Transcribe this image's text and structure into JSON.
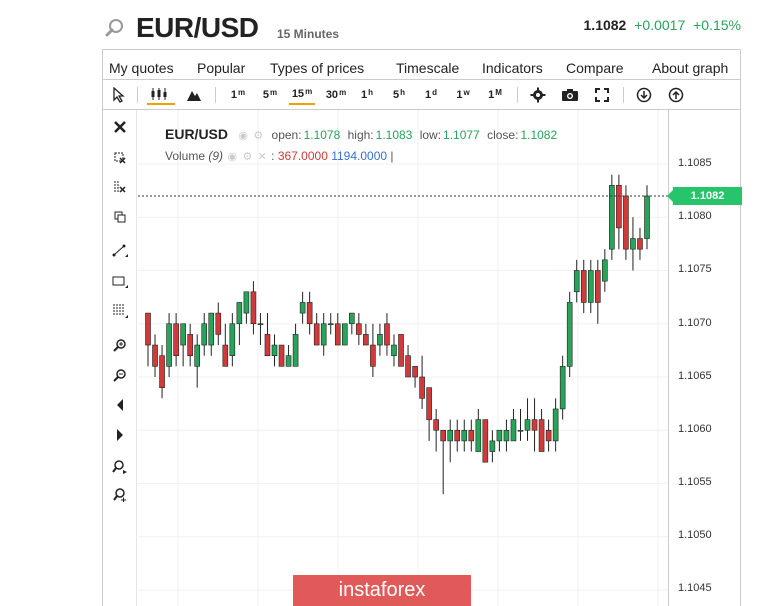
{
  "header": {
    "pair": "EUR/USD",
    "interval": "15 Minutes",
    "price": "1.1082",
    "change": "+0.0017",
    "change_pct": "+0.15%"
  },
  "menu": [
    "My quotes",
    "Popular",
    "Types of prices",
    "Timescale",
    "Indicators",
    "Compare",
    "About graph"
  ],
  "toolbar": {
    "timeframes": [
      {
        "base": "1",
        "sup": "m"
      },
      {
        "base": "5",
        "sup": "m"
      },
      {
        "base": "15",
        "sup": "m"
      },
      {
        "base": "30",
        "sup": "m"
      },
      {
        "base": "1",
        "sup": "h"
      },
      {
        "base": "5",
        "sup": "h"
      },
      {
        "base": "1",
        "sup": "d"
      },
      {
        "base": "1",
        "sup": "w"
      },
      {
        "base": "1",
        "sup": "M"
      }
    ],
    "active_timeframe": "15m"
  },
  "legend": {
    "symbol": "EUR/USD",
    "open_label": "open:",
    "open": "1.1078",
    "high_label": "high:",
    "high": "1.1083",
    "low_label": "low:",
    "low": "1.1077",
    "close_label": "close:",
    "close": "1.1082"
  },
  "volume": {
    "label": "Volume",
    "period": "(9)",
    "sep": ":",
    "val1": "367.0000",
    "val2": "1194.0000",
    "cursor": "|"
  },
  "price_axis": [
    "1.1085",
    "1.1080",
    "1.1075",
    "1.1070",
    "1.1065",
    "1.1060",
    "1.1055",
    "1.1050",
    "1.1045"
  ],
  "last_price_tag": "1.1082",
  "banner": "instaforex",
  "colors": {
    "up": "#27a35a",
    "down": "#d23a3a",
    "accent": "#f0a000",
    "tag": "#27c46b"
  },
  "chart_data": {
    "type": "candlestick",
    "ylim": [
      1.10425,
      1.10875
    ],
    "candles": [
      [
        1.1071,
        1.1068,
        1.1071,
        1.1066
      ],
      [
        1.1068,
        1.1066,
        1.1069,
        1.1065
      ],
      [
        1.1067,
        1.1064,
        1.1068,
        1.1063
      ],
      [
        1.1066,
        1.107,
        1.1071,
        1.1065
      ],
      [
        1.107,
        1.1067,
        1.1071,
        1.1066
      ],
      [
        1.1068,
        1.107,
        1.107,
        1.1066
      ],
      [
        1.1069,
        1.1067,
        1.107,
        1.1066
      ],
      [
        1.1066,
        1.1068,
        1.1069,
        1.1064
      ],
      [
        1.1068,
        1.107,
        1.1071,
        1.1067
      ],
      [
        1.1068,
        1.1071,
        1.1071,
        1.1067
      ],
      [
        1.1071,
        1.1069,
        1.1072,
        1.1068
      ],
      [
        1.1068,
        1.1066,
        1.107,
        1.1066
      ],
      [
        1.1067,
        1.107,
        1.1071,
        1.1066
      ],
      [
        1.107,
        1.1072,
        1.1072,
        1.1068
      ],
      [
        1.1071,
        1.1073,
        1.1073,
        1.107
      ],
      [
        1.1073,
        1.107,
        1.1074,
        1.1069
      ],
      [
        1.107,
        1.107,
        1.1071,
        1.1068
      ],
      [
        1.1069,
        1.1067,
        1.1071,
        1.1067
      ],
      [
        1.1067,
        1.1068,
        1.1069,
        1.1066
      ],
      [
        1.1068,
        1.1066,
        1.1068,
        1.1066
      ],
      [
        1.1066,
        1.1067,
        1.1068,
        1.1066
      ],
      [
        1.1066,
        1.1069,
        1.107,
        1.1066
      ],
      [
        1.1071,
        1.1072,
        1.1073,
        1.107
      ],
      [
        1.1072,
        1.107,
        1.1073,
        1.1069
      ],
      [
        1.107,
        1.1068,
        1.1071,
        1.1068
      ],
      [
        1.1068,
        1.107,
        1.1071,
        1.1067
      ],
      [
        1.107,
        1.107,
        1.1071,
        1.1069
      ],
      [
        1.107,
        1.1068,
        1.1071,
        1.1068
      ],
      [
        1.1068,
        1.107,
        1.107,
        1.1068
      ],
      [
        1.107,
        1.1071,
        1.1071,
        1.1069
      ],
      [
        1.107,
        1.1069,
        1.1071,
        1.1068
      ],
      [
        1.1069,
        1.1068,
        1.107,
        1.1068
      ],
      [
        1.1068,
        1.1066,
        1.107,
        1.1065
      ],
      [
        1.1068,
        1.1069,
        1.107,
        1.1067
      ],
      [
        1.107,
        1.1068,
        1.1071,
        1.1067
      ],
      [
        1.1067,
        1.1068,
        1.1069,
        1.1066
      ],
      [
        1.1069,
        1.1066,
        1.1069,
        1.1066
      ],
      [
        1.1067,
        1.1065,
        1.1068,
        1.1065
      ],
      [
        1.1066,
        1.1065,
        1.1066,
        1.1064
      ],
      [
        1.1065,
        1.1063,
        1.1067,
        1.1062
      ],
      [
        1.1064,
        1.1061,
        1.1064,
        1.1059
      ],
      [
        1.1061,
        1.106,
        1.1062,
        1.1058
      ],
      [
        1.106,
        1.1059,
        1.106,
        1.1054
      ],
      [
        1.1059,
        1.106,
        1.1061,
        1.1057
      ],
      [
        1.106,
        1.1059,
        1.1061,
        1.1058
      ],
      [
        1.1059,
        1.106,
        1.1061,
        1.1058
      ],
      [
        1.106,
        1.1059,
        1.1061,
        1.1058
      ],
      [
        1.1058,
        1.1061,
        1.1062,
        1.1058
      ],
      [
        1.1061,
        1.1057,
        1.1061,
        1.1057
      ],
      [
        1.1058,
        1.1059,
        1.106,
        1.1057
      ],
      [
        1.1059,
        1.106,
        1.106,
        1.1058
      ],
      [
        1.1059,
        1.106,
        1.1061,
        1.1058
      ],
      [
        1.1059,
        1.1061,
        1.1062,
        1.1059
      ],
      [
        1.106,
        1.106,
        1.1062,
        1.1059
      ],
      [
        1.106,
        1.1061,
        1.1063,
        1.1059
      ],
      [
        1.1061,
        1.106,
        1.1063,
        1.1058
      ],
      [
        1.1061,
        1.1058,
        1.1062,
        1.1058
      ],
      [
        1.106,
        1.1059,
        1.1061,
        1.1058
      ],
      [
        1.1059,
        1.1062,
        1.1063,
        1.1058
      ],
      [
        1.1062,
        1.1066,
        1.1067,
        1.1061
      ],
      [
        1.1066,
        1.1072,
        1.1073,
        1.1065
      ],
      [
        1.1073,
        1.1075,
        1.1076,
        1.1072
      ],
      [
        1.1075,
        1.1072,
        1.1076,
        1.1071
      ],
      [
        1.1072,
        1.1075,
        1.1076,
        1.1071
      ],
      [
        1.1075,
        1.1072,
        1.1076,
        1.107
      ],
      [
        1.1074,
        1.1076,
        1.1077,
        1.1073
      ],
      [
        1.1077,
        1.1083,
        1.1084,
        1.1076
      ],
      [
        1.1083,
        1.1079,
        1.1084,
        1.1077
      ],
      [
        1.1082,
        1.1077,
        1.1083,
        1.1076
      ],
      [
        1.1077,
        1.1078,
        1.108,
        1.1075
      ],
      [
        1.1078,
        1.1077,
        1.1079,
        1.1076
      ],
      [
        1.1078,
        1.1082,
        1.1083,
        1.1077
      ]
    ]
  }
}
